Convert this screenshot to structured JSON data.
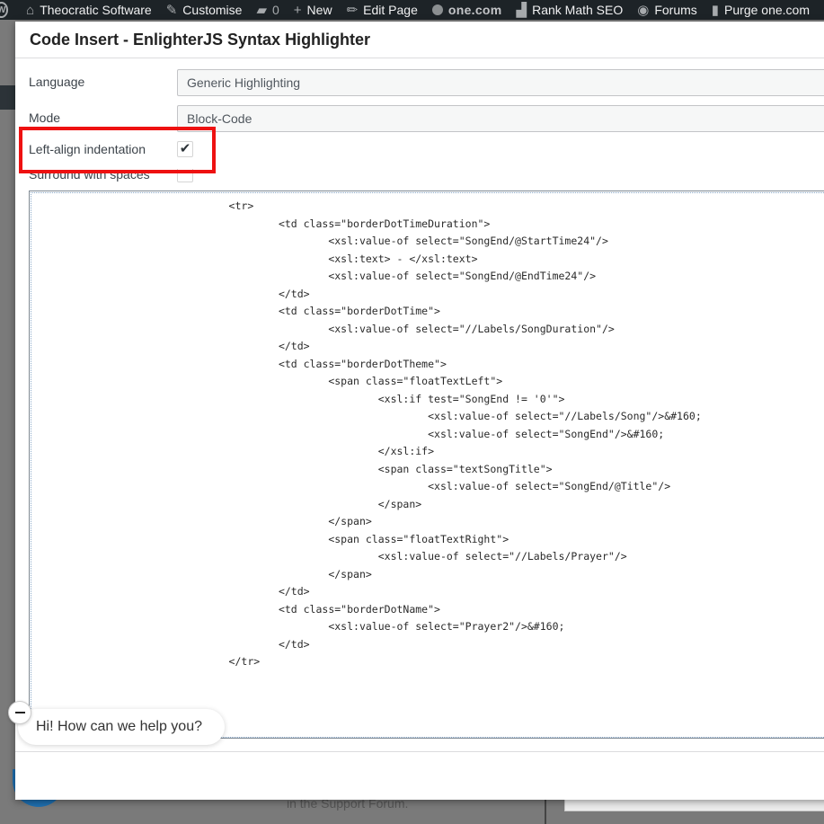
{
  "adminbar": {
    "items": [
      {
        "icon": "home-icon",
        "label": "Theocratic Software"
      },
      {
        "icon": "brush-icon",
        "label": "Customise"
      },
      {
        "icon": "comment-icon",
        "label": "0"
      },
      {
        "icon": "plus-icon",
        "label": "New"
      },
      {
        "icon": "pencil-icon",
        "label": "Edit Page"
      },
      {
        "icon": "onecom-icon",
        "label": "one.com"
      },
      {
        "icon": "rankmath-icon",
        "label": "Rank Math SEO"
      },
      {
        "icon": "forums-icon",
        "label": "Forums"
      },
      {
        "icon": "trash-icon",
        "label": "Purge one.com"
      }
    ]
  },
  "dialog": {
    "title": "Code Insert - EnlighterJS Syntax Highlighter",
    "language_label": "Language",
    "language_value": "Generic Highlighting",
    "mode_label": "Mode",
    "mode_value": "Block-Code",
    "left_align_label": "Left-align indentation",
    "left_align_checked": true,
    "surround_label": "Surround with spaces",
    "surround_checked": false
  },
  "code": {
    "lines": [
      "                                <tr>",
      "                                        <td class=\"borderDotTimeDuration\">",
      "                                                <xsl:value-of select=\"SongEnd/@StartTime24\"/>",
      "                                                <xsl:text> - </xsl:text>",
      "                                                <xsl:value-of select=\"SongEnd/@EndTime24\"/>",
      "                                        </td>",
      "                                        <td class=\"borderDotTime\">",
      "                                                <xsl:value-of select=\"//Labels/SongDuration\"/>",
      "                                        </td>",
      "                                        <td class=\"borderDotTheme\">",
      "                                                <span class=\"floatTextLeft\">",
      "                                                        <xsl:if test=\"SongEnd != '0'\">",
      "                                                                <xsl:value-of select=\"//Labels/Song\"/>&#160;",
      "                                                                <xsl:value-of select=\"SongEnd\"/>&#160;",
      "                                                        </xsl:if>",
      "                                                        <span class=\"textSongTitle\">",
      "                                                                <xsl:value-of select=\"SongEnd/@Title\"/>",
      "                                                        </span>",
      "                                                </span>",
      "                                                <span class=\"floatTextRight\">",
      "                                                        <xsl:value-of select=\"//Labels/Prayer\"/>",
      "                                                </span>",
      "                                        </td>",
      "                                        <td class=\"borderDotName\">",
      "                                                <xsl:value-of select=\"Prayer2\"/>&#160;",
      "                                        </td>",
      "                                </tr>"
    ]
  },
  "chat": {
    "message": "Hi! How can we help you?"
  },
  "background": {
    "bottom_text": "in the Support Forum."
  }
}
